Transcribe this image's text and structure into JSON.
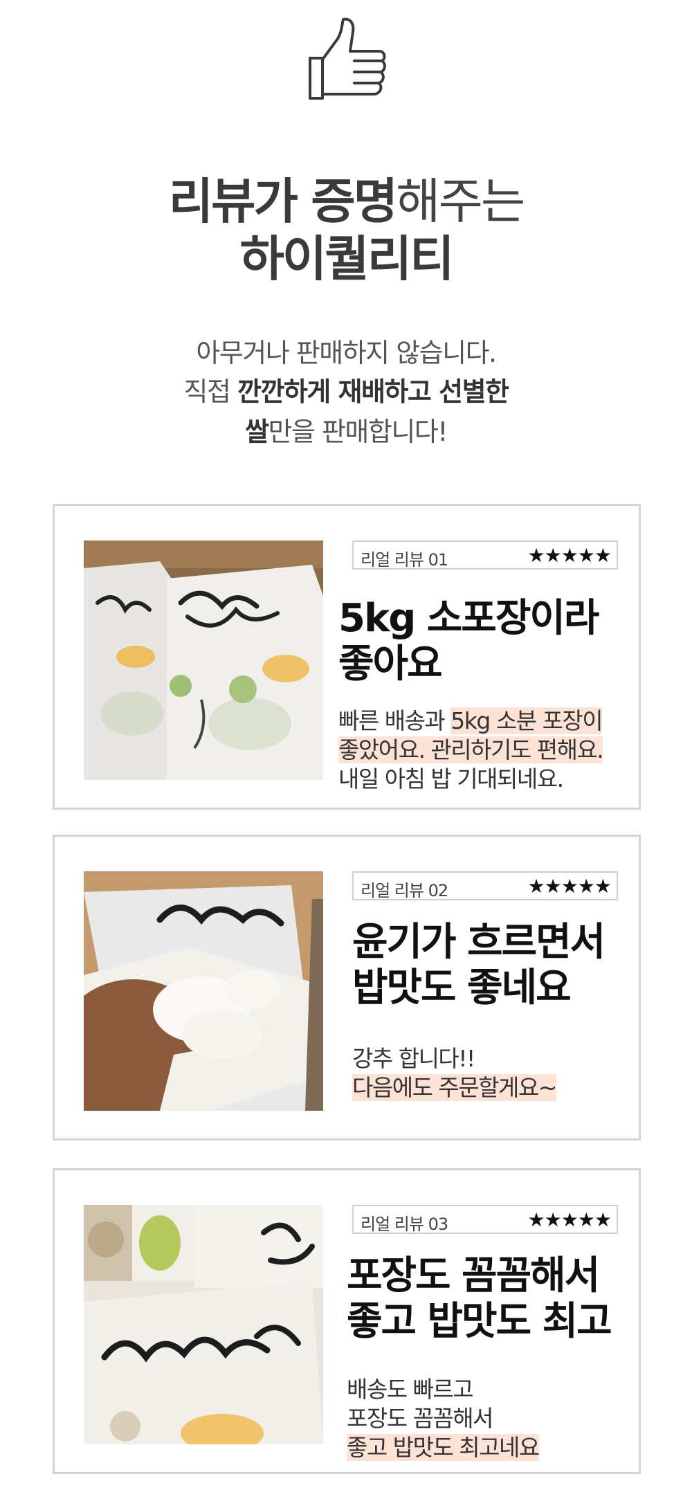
{
  "headline": {
    "line1_bold": "리뷰가 증명",
    "line1_light": "해주는",
    "line2": "하이퀄리티"
  },
  "intro": {
    "line1": "아무거나 판매하지 않습니다.",
    "line2_prefix": "직접 ",
    "line2_bold": "깐깐하게 재배하고 선별한",
    "line3_bold": "쌀",
    "line3_rest": "만을 판매합니다!"
  },
  "icons": {
    "top": "thumbs-up-icon"
  },
  "colors": {
    "highlight": "#fde3d6",
    "card_border": "#d3d3d3",
    "text": "#333333"
  },
  "reviews": [
    {
      "tag": "리얼 리뷰 01",
      "stars": "★★★★★",
      "title_lines": [
        "5kg 소포장이라",
        "좋아요"
      ],
      "body": {
        "l1_plain": "빠른 배송과 ",
        "l1_hl": "5kg 소분 포장이",
        "l2_hl": "좋았어요. 관리하기도 편해요.",
        "l3_plain": "내일 아침 밥 기대되네요."
      }
    },
    {
      "tag": "리얼 리뷰 02",
      "stars": "★★★★★",
      "title_lines": [
        "윤기가 흐르면서",
        "밥맛도 좋네요"
      ],
      "body": {
        "l1_plain": "강추 합니다!!",
        "l2_hl": "다음에도 주문할게요~"
      }
    },
    {
      "tag": "리얼 리뷰 03",
      "stars": "★★★★★",
      "title_lines": [
        "포장도 꼼꼼해서",
        "좋고 밥맛도 최고"
      ],
      "body": {
        "l1_plain": "배송도 빠르고",
        "l2_plain": "포장도 꼼꼼해서",
        "l3_hl": "좋고 밥맛도 최고네요"
      }
    }
  ]
}
